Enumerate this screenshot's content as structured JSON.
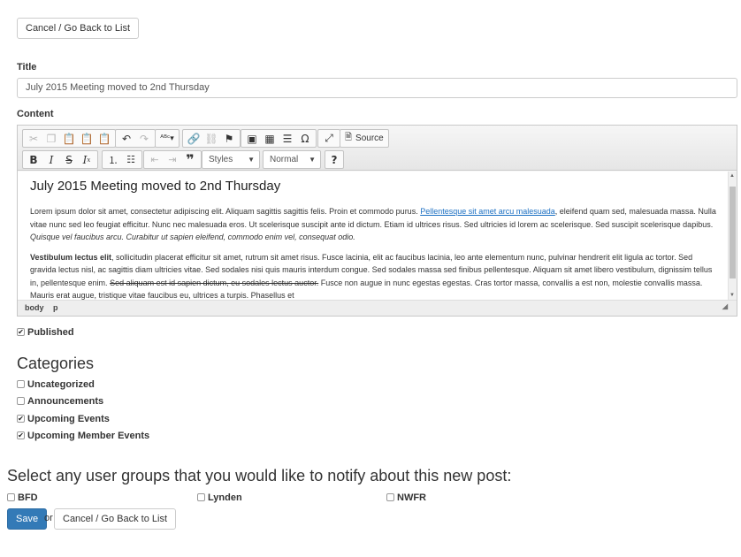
{
  "actions": {
    "cancel_label": "Cancel / Go Back to List",
    "save_label": "Save",
    "or_text": "or"
  },
  "title_field": {
    "label": "Title",
    "value": "July 2015 Meeting moved to 2nd Thursday"
  },
  "content_field": {
    "label": "Content"
  },
  "editor": {
    "toolbar_row1": [
      {
        "icon": "cut-icon",
        "disabled": true
      },
      {
        "icon": "copy-icon",
        "disabled": true
      },
      {
        "icon": "paste-icon",
        "disabled": false
      },
      {
        "icon": "paste-text-icon",
        "disabled": false
      },
      {
        "icon": "paste-word-icon",
        "disabled": false
      },
      {
        "icon": "undo-icon",
        "disabled": false
      },
      {
        "icon": "redo-icon",
        "disabled": true
      },
      {
        "icon": "spellcheck-icon",
        "disabled": false
      },
      {
        "icon": "link-icon",
        "disabled": false
      },
      {
        "icon": "unlink-icon",
        "disabled": true
      },
      {
        "icon": "anchor-icon",
        "disabled": false
      },
      {
        "icon": "image-icon",
        "disabled": false
      },
      {
        "icon": "table-icon",
        "disabled": false
      },
      {
        "icon": "horizontal-rule-icon",
        "disabled": false
      },
      {
        "icon": "special-char-icon",
        "disabled": false
      },
      {
        "icon": "maximize-icon",
        "disabled": false
      }
    ],
    "source_label": "Source",
    "styles_label": "Styles",
    "format_label": "Normal",
    "help_label": "?",
    "heading": "July 2015 Meeting moved to 2nd Thursday",
    "p1_before_link": "Lorem ipsum dolor sit amet, consectetur adipiscing elit. Aliquam sagittis sagittis felis. Proin et commodo purus. ",
    "p1_link": "Pellentesque sit amet arcu malesuada",
    "p1_after_link": ", eleifend quam sed, malesuada massa. Nulla vitae nunc sed leo feugiat efficitur. Nunc nec malesuada eros. Ut scelerisque suscipit ante id dictum. Etiam id ultrices risus. Sed ultricies id lorem ac scelerisque. Sed suscipit scelerisque dapibus. ",
    "p1_italic": "Quisque vel faucibus arcu. Curabitur ut sapien eleifend, commodo enim vel, consequat odio.",
    "p2_bold": "Vestibulum lectus elit",
    "p2_text": ", sollicitudin placerat efficitur sit amet, rutrum sit amet risus. Fusce lacinia, elit ac faucibus lacinia, leo ante elementum nunc, pulvinar hendrerit elit ligula ac tortor. Sed gravida lectus nisl, ac sagittis diam ultricies vitae. Sed sodales nisi quis mauris interdum congue. Sed sodales massa sed finibus pellentesque. Aliquam sit amet libero vestibulum, dignissim tellus in, pellentesque enim. ",
    "p2_strike": "Sed aliquam est id sapien dictum, eu sodales lectus auctor.",
    "p2_after_strike": " Fusce non augue in nunc egestas egestas. Cras tortor massa, convallis a est non, molestie convallis massa. Mauris erat augue, tristique vitae faucibus eu, ultrices a turpis. Phasellus et",
    "path": [
      "body",
      "p"
    ]
  },
  "published": {
    "label": "Published",
    "checked": true
  },
  "categories": {
    "heading": "Categories",
    "items": [
      {
        "label": "Uncategorized",
        "checked": false
      },
      {
        "label": "Announcements",
        "checked": false
      },
      {
        "label": "Upcoming Events",
        "checked": true
      },
      {
        "label": "Upcoming Member Events",
        "checked": true
      }
    ]
  },
  "notify": {
    "heading": "Select any user groups that you would like to notify about this new post:",
    "groups": [
      {
        "label": "BFD",
        "checked": false
      },
      {
        "label": "Lynden",
        "checked": false
      },
      {
        "label": "NWFR",
        "checked": false
      }
    ]
  }
}
